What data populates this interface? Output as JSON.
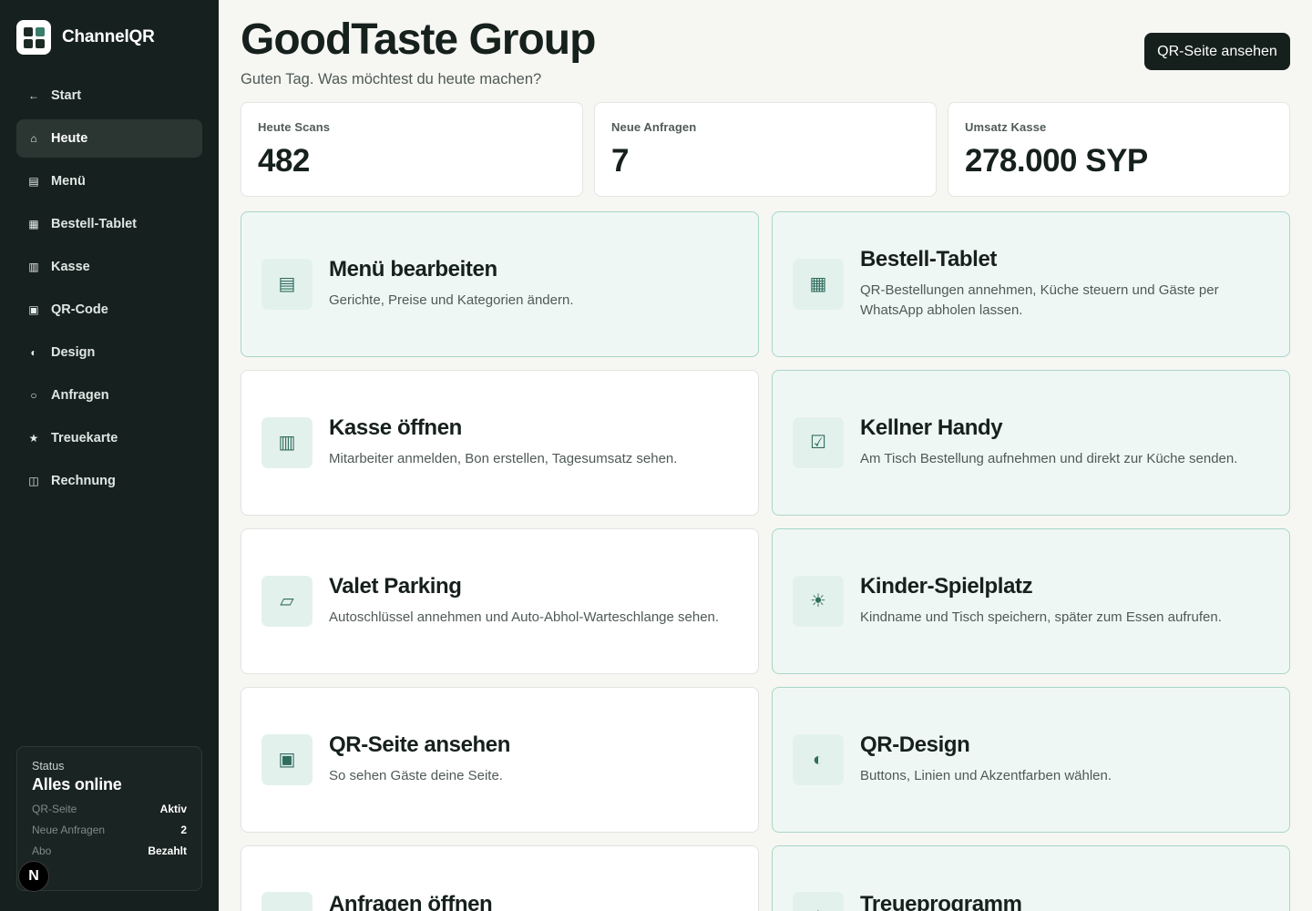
{
  "brand": {
    "name": "ChannelQR"
  },
  "sidebar": {
    "items": [
      {
        "label": "Start",
        "icon": "arrow-left-icon",
        "glyph": "←"
      },
      {
        "label": "Heute",
        "icon": "home-icon",
        "glyph": "⌂",
        "active": true
      },
      {
        "label": "Menü",
        "icon": "menu-list-icon",
        "glyph": "▤"
      },
      {
        "label": "Bestell-Tablet",
        "icon": "tablet-grid-icon",
        "glyph": "▦"
      },
      {
        "label": "Kasse",
        "icon": "register-icon",
        "glyph": "▥"
      },
      {
        "label": "QR-Code",
        "icon": "qr-code-icon",
        "glyph": "▣"
      },
      {
        "label": "Design",
        "icon": "contrast-icon",
        "glyph": "◐"
      },
      {
        "label": "Anfragen",
        "icon": "circle-icon",
        "glyph": "○"
      },
      {
        "label": "Treuekarte",
        "icon": "star-icon",
        "glyph": "★"
      },
      {
        "label": "Rechnung",
        "icon": "invoice-icon",
        "glyph": "◫"
      }
    ],
    "status": {
      "kicker": "Status",
      "title": "Alles online",
      "rows": [
        {
          "key": "QR-Seite",
          "value": "Aktiv"
        },
        {
          "key": "Neue Anfragen",
          "value": "2"
        },
        {
          "key": "Abo",
          "value": "Bezahlt"
        }
      ]
    },
    "dev_badge": "N"
  },
  "header": {
    "title": "GoodTaste Group",
    "subtitle": "Guten Tag. Was möchtest du heute machen?",
    "button_label": "QR-Seite ansehen"
  },
  "stats": [
    {
      "label": "Heute Scans",
      "value": "482"
    },
    {
      "label": "Neue Anfragen",
      "value": "7"
    },
    {
      "label": "Umsatz Kasse",
      "value": "278.000 SYP"
    }
  ],
  "cards": [
    {
      "title": "Menü bearbeiten",
      "desc": "Gerichte, Preise und Kategorien ändern.",
      "icon": "menu-list-icon",
      "glyph": "▤"
    },
    {
      "title": "Bestell-Tablet",
      "desc": "QR-Bestellungen annehmen, Küche steuern und Gäste per WhatsApp abholen lassen.",
      "icon": "tablet-grid-icon",
      "glyph": "▦"
    },
    {
      "title": "Kasse öffnen",
      "desc": "Mitarbeiter anmelden, Bon erstellen, Tagesumsatz sehen.",
      "icon": "register-icon",
      "glyph": "▥"
    },
    {
      "title": "Kellner Handy",
      "desc": "Am Tisch Bestellung aufnehmen und direkt zur Küche senden.",
      "icon": "checkbox-icon",
      "glyph": "☑"
    },
    {
      "title": "Valet Parking",
      "desc": "Autoschlüssel annehmen und Auto-Abhol-Warteschlange sehen.",
      "icon": "parking-ticket-icon",
      "glyph": "▱"
    },
    {
      "title": "Kinder-Spielplatz",
      "desc": "Kindname und Tisch speichern, später zum Essen aufrufen.",
      "icon": "sun-icon",
      "glyph": "☀"
    },
    {
      "title": "QR-Seite ansehen",
      "desc": "So sehen Gäste deine Seite.",
      "icon": "qr-code-icon",
      "glyph": "▣"
    },
    {
      "title": "QR-Design",
      "desc": "Buttons, Linien und Akzentfarben wählen.",
      "icon": "contrast-icon",
      "glyph": "◐"
    },
    {
      "title": "Anfragen öffnen",
      "desc": "",
      "icon": "circle-icon",
      "glyph": "○"
    },
    {
      "title": "Treueprogramm",
      "desc": "",
      "icon": "star-icon",
      "glyph": "★"
    }
  ],
  "colors": {
    "sidebar_bg": "#16201e",
    "accent": "#2f6d5e",
    "card_tint_bg": "#eff7f4",
    "card_tint_border": "#a9d6c9",
    "primary_button": "#15201d"
  }
}
